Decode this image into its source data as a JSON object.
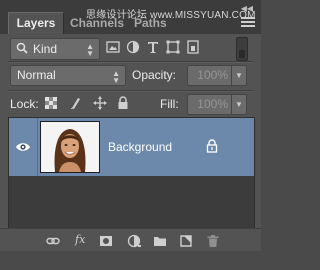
{
  "header": {
    "watermark": "思缘设计论坛 www.MISSYUAN.COM",
    "tabs": [
      {
        "label": "Layers",
        "active": true
      },
      {
        "label": "Channels",
        "active": false
      },
      {
        "label": "Paths",
        "active": false
      }
    ],
    "collapse_glyph": "◀◀",
    "panel_menu_icon": "hamburger-menu-icon"
  },
  "filter": {
    "selected": "Kind",
    "icons": [
      "image-filter-icon",
      "adjustment-filter-icon",
      "type-filter-icon",
      "shape-filter-icon",
      "smart-object-filter-icon"
    ]
  },
  "blend": {
    "mode": "Normal",
    "opacity_label": "Opacity:",
    "opacity_value": "100%"
  },
  "lock": {
    "label": "Lock:",
    "icons": [
      "lock-transparent-pixels-icon",
      "lock-image-pixels-icon",
      "lock-position-icon",
      "lock-all-icon"
    ],
    "fill_label": "Fill:",
    "fill_value": "100%"
  },
  "layers": [
    {
      "name": "Background",
      "visible": true,
      "locked": true,
      "selected": true
    }
  ],
  "footer": {
    "fx_label": "fx",
    "icons": [
      "link-layers-icon",
      "layer-style-icon",
      "add-mask-icon",
      "adjustment-layer-icon",
      "group-folder-icon",
      "new-layer-icon",
      "delete-layer-icon"
    ]
  },
  "colors": {
    "panel_bg": "#535353",
    "header_bg": "#3c3c3c",
    "selected_row": "#6c89ab",
    "field_bg": "#6b6b6b"
  }
}
